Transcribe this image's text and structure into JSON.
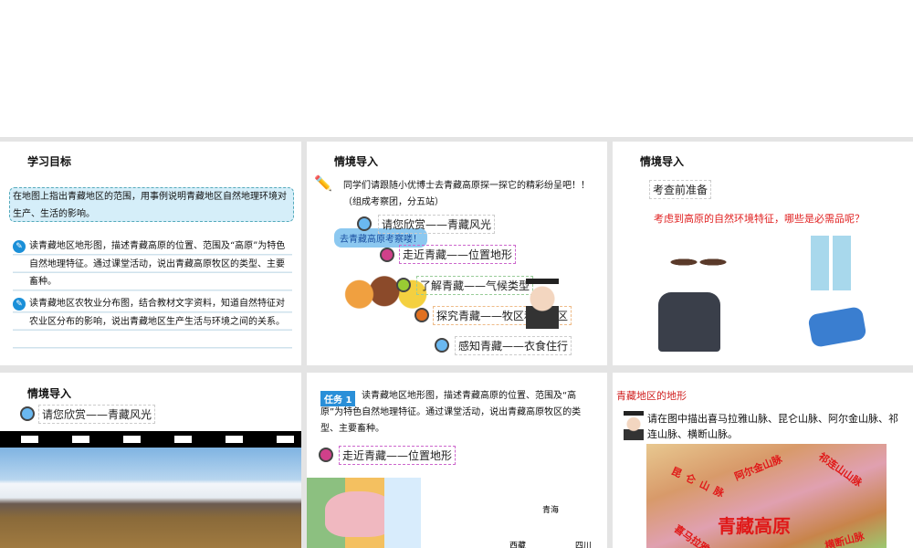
{
  "slides": [
    {
      "title": "学习目标",
      "goal": "在地图上指出青藏地区的范围，用事例说明青藏地区自然地理环境对生产、生活的影响。",
      "items": [
        "读青藏地区地形图，描述青藏高原的位置、范围及“高原”为特色自然地理特征。通过课堂活动，说出青藏高原牧区的类型、主要畜种。",
        "读青藏地区农牧业分布图，结合教材文字资料，知道自然特征对农业区分布的影响，说出青藏地区生产生活与环境之间的关系。"
      ]
    },
    {
      "title": "情境导入",
      "intro": "同学们请跟随小优博士去青藏高原探一探它的精彩纷呈吧！！（组成考察团，分五站）",
      "bubble": "去青藏高原考察喽！",
      "stops": [
        "请您欣赏——青藏风光",
        "走近青藏——位置地形",
        "了解青藏——气候类型",
        "探究青藏——牧区和农业区",
        "感知青藏——衣食住行"
      ]
    },
    {
      "title": "情境导入",
      "label": "考查前准备",
      "question": "考虑到高原的自然环境特征，哪些是必需品呢？"
    },
    {
      "title": "情境导入",
      "stop": "请您欣赏——青藏风光"
    },
    {
      "badge": "任务 1",
      "task": "读青藏地区地形图，描述青藏高原的位置、范围及“高原”为特色自然地理特征。通过课堂活动，说出青藏高原牧区的类型、主要畜种。",
      "stop": "走近青藏——位置地形",
      "map_labels": [
        "青海",
        "西藏",
        "四川"
      ]
    },
    {
      "title": "青藏地区的地形",
      "instruction": "请在图中描出喜马拉雅山脉、昆仑山脉、阿尔金山脉、祁连山脉、横断山脉。",
      "map_labels": [
        "阿尔金山脉",
        "祁连山山脉",
        "昆仑山脉",
        "青藏高原",
        "喜马拉雅",
        "横断山脉"
      ]
    }
  ],
  "colors": {
    "red": "#e02020",
    "gray": "#e4e4e4"
  }
}
